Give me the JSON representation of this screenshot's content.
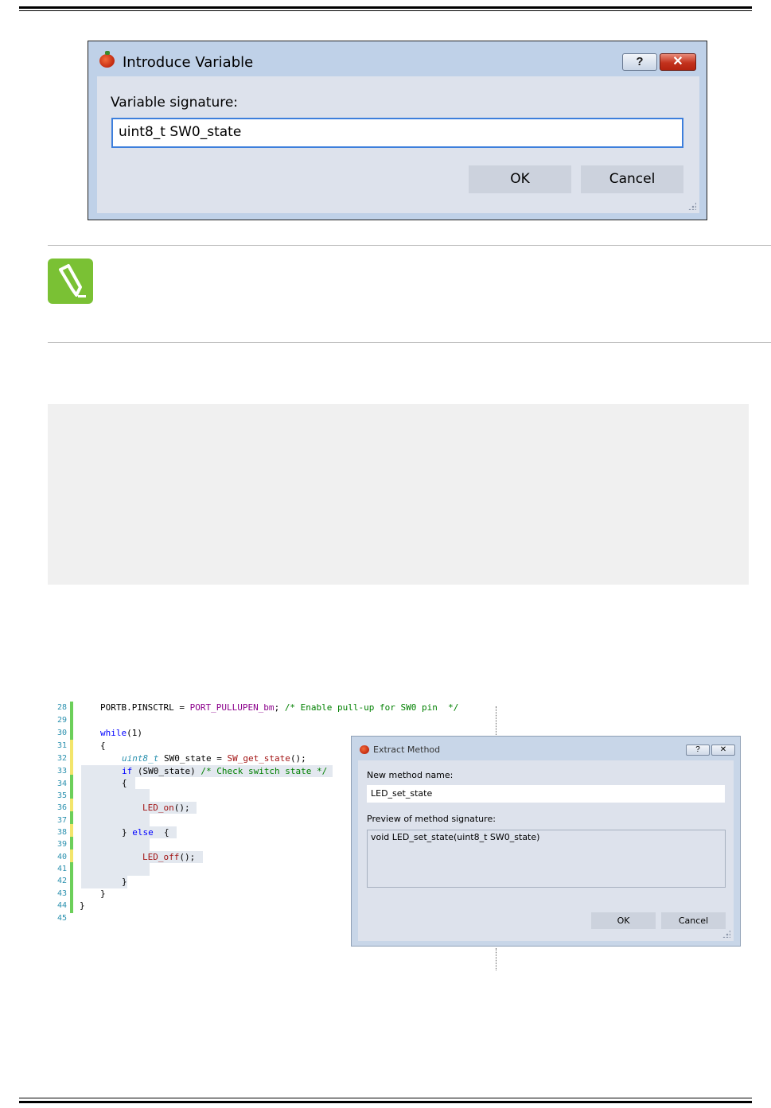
{
  "introduce_variable": {
    "title": "Introduce Variable",
    "help_label": "?",
    "close_label": "✕",
    "label": "Variable signature:",
    "value": "uint8_t SW0_state",
    "ok_label": "OK",
    "cancel_label": "Cancel"
  },
  "editor": {
    "line_numbers": [
      "28",
      "29",
      "30",
      "31",
      "32",
      "33",
      "34",
      "35",
      "36",
      "37",
      "38",
      "39",
      "40",
      "41",
      "42",
      "43",
      "44",
      "45"
    ],
    "line28": {
      "a": "PORTB.PINSCTRL = ",
      "b": "PORT_PULLUPEN_bm",
      "c": "; ",
      "d": "/* Enable pull-up for SW0 pin  */"
    },
    "line30": {
      "a": "while",
      "b": "(1)"
    },
    "line31": "{",
    "line32": {
      "a": "uint8_t",
      "b": " SW0_state = ",
      "c": "SW_get_state",
      "d": "();"
    },
    "line33": {
      "a": "if",
      "b": " (SW0_state) ",
      "c": "/* Check switch state */"
    },
    "line34": "{",
    "line36": {
      "a": "LED_on",
      "b": "();"
    },
    "line38": {
      "a": "} ",
      "b": "else",
      "c": "  {"
    },
    "line40": {
      "a": "LED_off",
      "b": "();"
    },
    "line42": "}",
    "line43": "}",
    "line44": "}"
  },
  "extract_method": {
    "title": "Extract Method",
    "help_label": "?",
    "close_label": "✕",
    "name_label": "New method name:",
    "name_value": "LED_set_state",
    "preview_label": "Preview of method signature:",
    "preview_value": "void LED_set_state(uint8_t SW0_state)",
    "ok_label": "OK",
    "cancel_label": "Cancel"
  }
}
